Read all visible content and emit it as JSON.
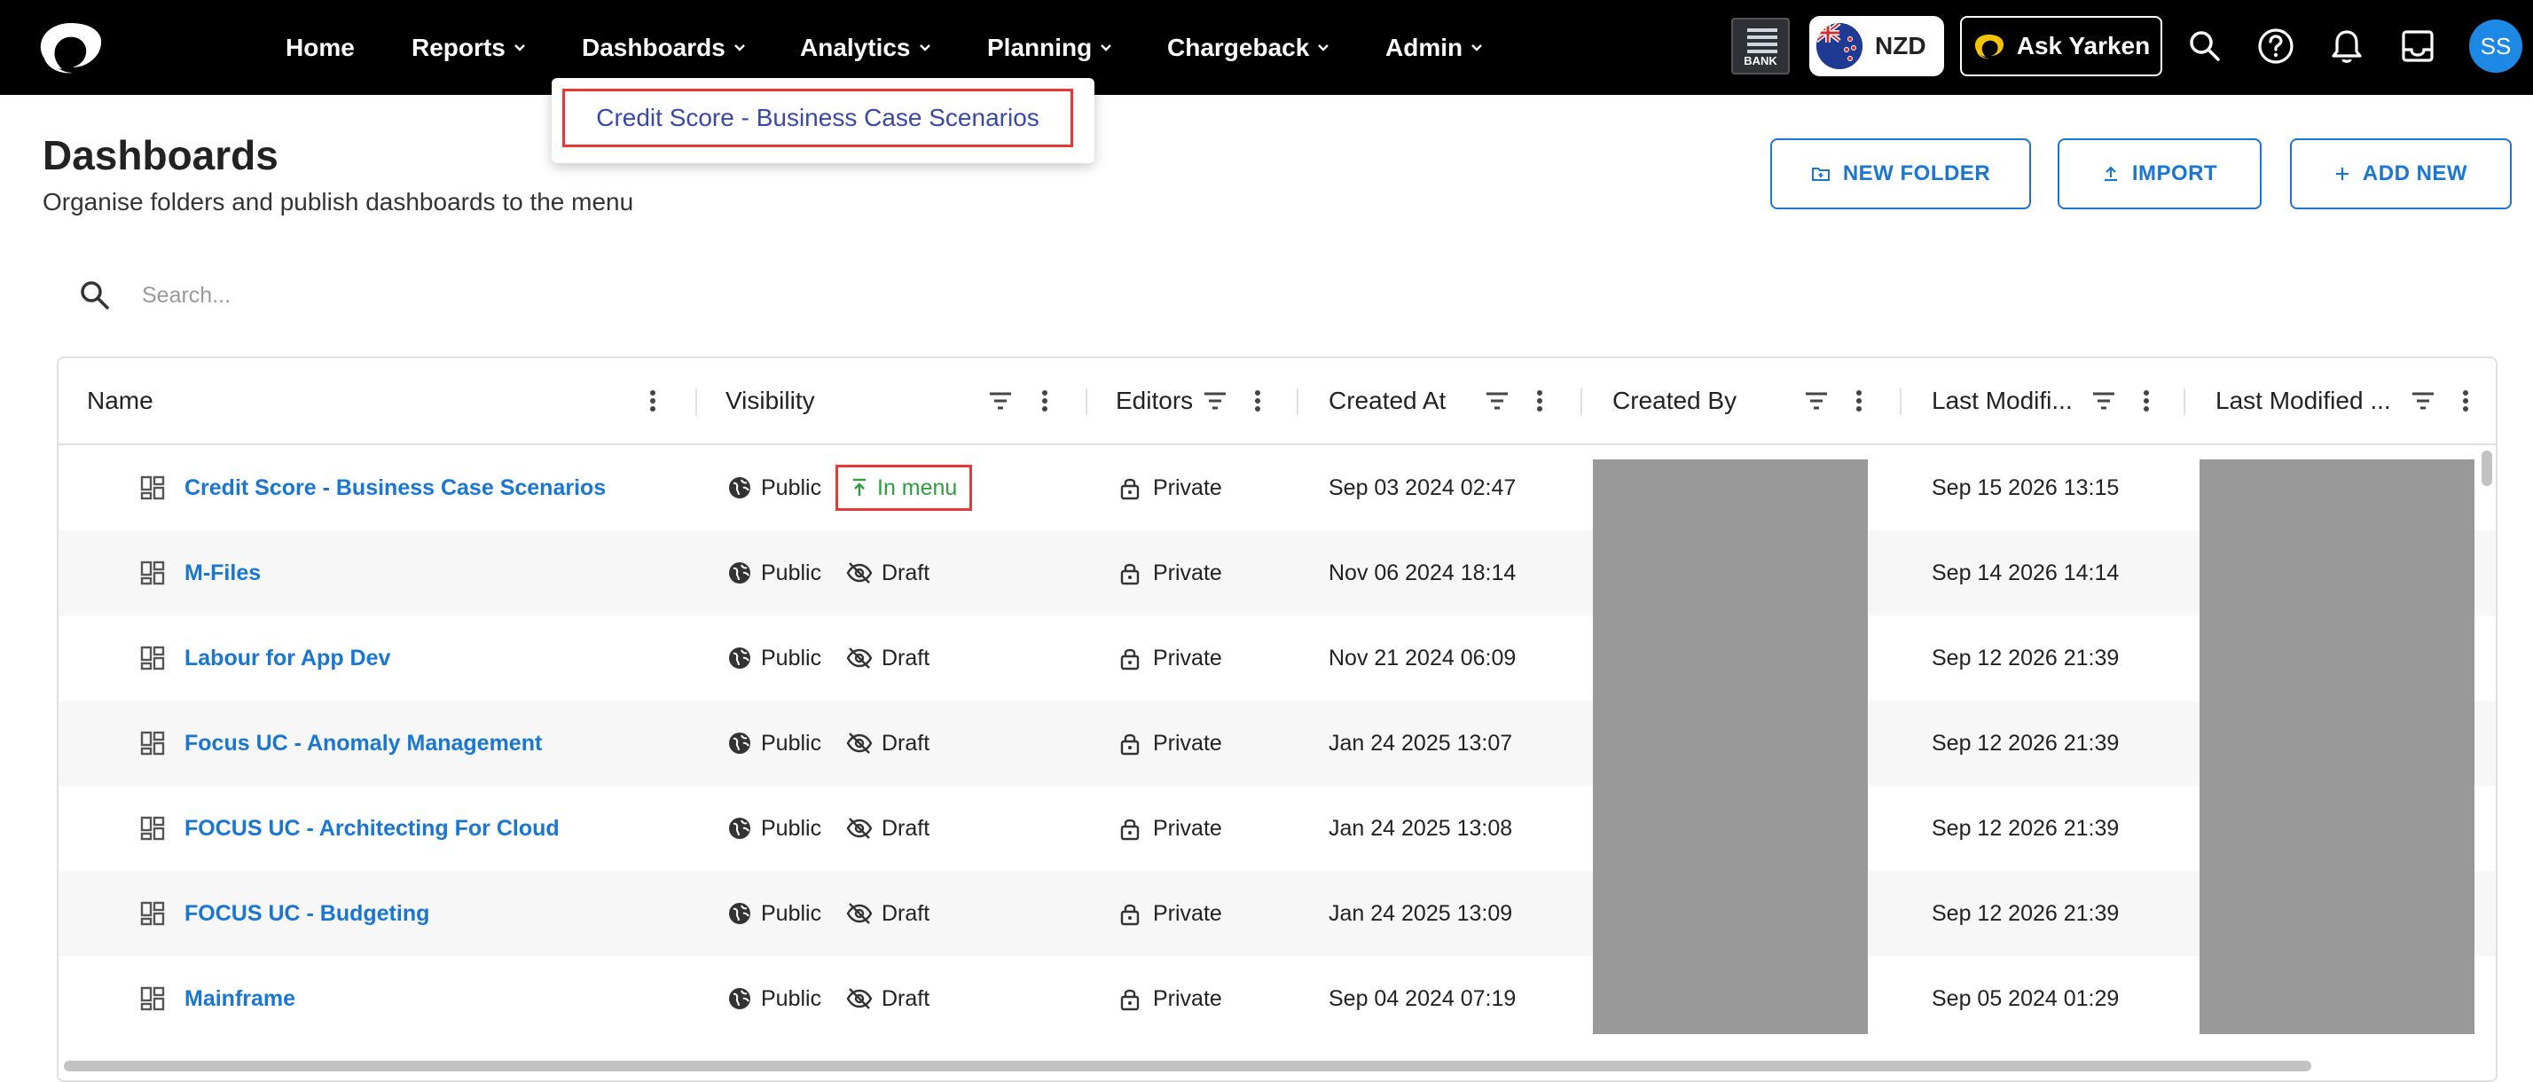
{
  "nav": {
    "items": [
      {
        "label": "Home",
        "has_menu": false
      },
      {
        "label": "Reports",
        "has_menu": true
      },
      {
        "label": "Dashboards",
        "has_menu": true
      },
      {
        "label": "Analytics",
        "has_menu": true
      },
      {
        "label": "Planning",
        "has_menu": true
      },
      {
        "label": "Chargeback",
        "has_menu": true
      },
      {
        "label": "Admin",
        "has_menu": true
      }
    ],
    "bank_label": "BANK",
    "currency": "NZD",
    "ask_label": "Ask Yarken",
    "avatar_initials": "SS"
  },
  "dashboards_menu": {
    "items": [
      "Credit Score - Business Case Scenarios"
    ]
  },
  "page": {
    "title": "Dashboards",
    "subtitle": "Organise folders and publish dashboards to the menu",
    "buttons": {
      "new_folder": "NEW FOLDER",
      "import": "IMPORT",
      "add_new": "ADD NEW"
    }
  },
  "search": {
    "placeholder": "Search..."
  },
  "table": {
    "columns": [
      "Name",
      "Visibility",
      "Editors",
      "Created At",
      "Created By",
      "Last Modifi...",
      "Last Modified ..."
    ],
    "rows": [
      {
        "name": "Credit Score - Business Case Scenarios",
        "visibility": "Public",
        "status": "In menu",
        "editors": "Private",
        "created_at": "Sep 03 2024 02:47",
        "last_modified_at": "Sep 15 2026 13:15"
      },
      {
        "name": "M-Files",
        "visibility": "Public",
        "status": "Draft",
        "editors": "Private",
        "created_at": "Nov 06 2024 18:14",
        "last_modified_at": "Sep 14 2026 14:14"
      },
      {
        "name": "Labour for App Dev",
        "visibility": "Public",
        "status": "Draft",
        "editors": "Private",
        "created_at": "Nov 21 2024 06:09",
        "last_modified_at": "Sep 12 2026 21:39"
      },
      {
        "name": "Focus UC - Anomaly Management",
        "visibility": "Public",
        "status": "Draft",
        "editors": "Private",
        "created_at": "Jan 24 2025 13:07",
        "last_modified_at": "Sep 12 2026 21:39"
      },
      {
        "name": "FOCUS UC - Architecting For Cloud",
        "visibility": "Public",
        "status": "Draft",
        "editors": "Private",
        "created_at": "Jan 24 2025 13:08",
        "last_modified_at": "Sep 12 2026 21:39"
      },
      {
        "name": "FOCUS UC - Budgeting",
        "visibility": "Public",
        "status": "Draft",
        "editors": "Private",
        "created_at": "Jan 24 2025 13:09",
        "last_modified_at": "Sep 12 2026 21:39"
      },
      {
        "name": "Mainframe",
        "visibility": "Public",
        "status": "Draft",
        "editors": "Private",
        "created_at": "Sep 04 2024 07:19",
        "last_modified_at": "Sep 05 2024 01:29"
      }
    ]
  },
  "colors": {
    "accent": "#1976d2",
    "highlight": "#e53935",
    "in_menu": "#2e9d3e",
    "redacted": "#999999"
  }
}
